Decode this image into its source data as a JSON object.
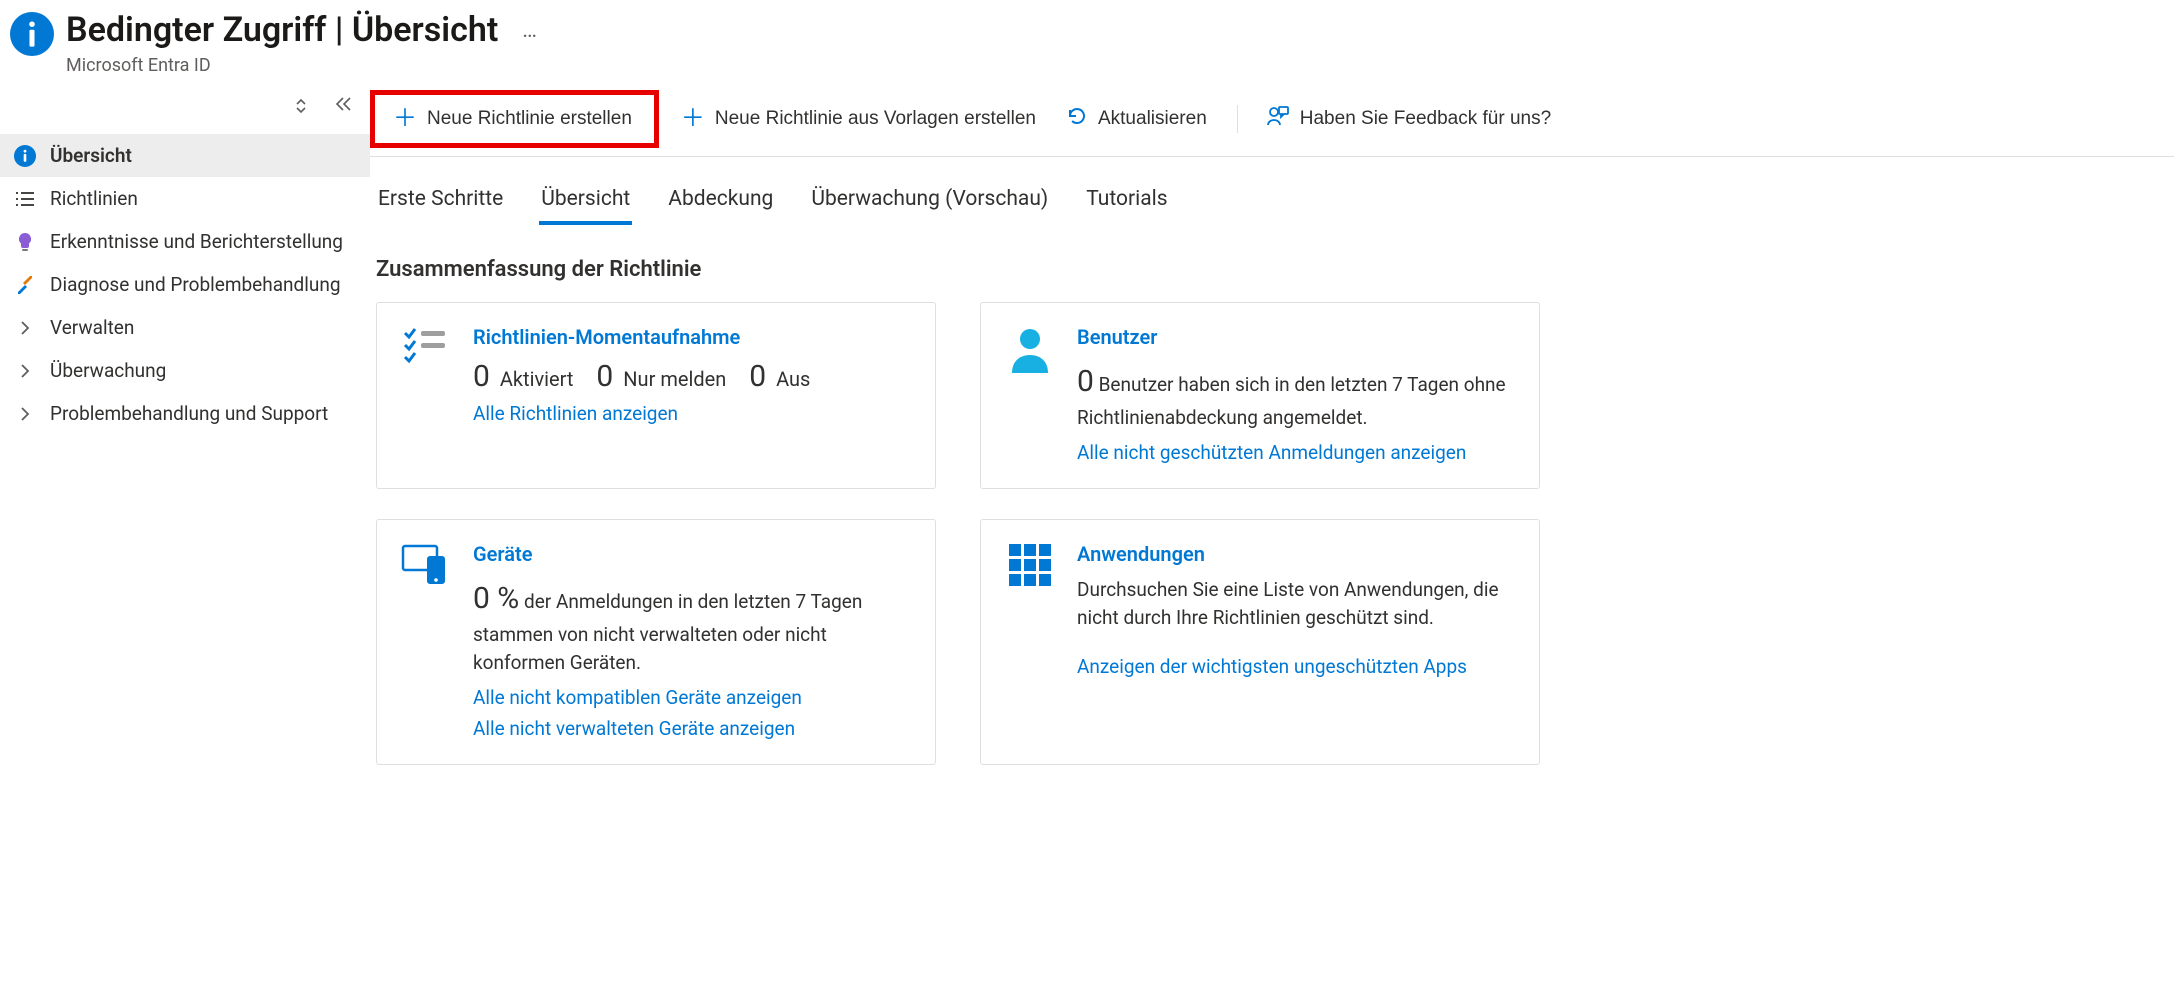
{
  "header": {
    "title": "Bedingter Zugriff | Übersicht",
    "subtitle": "Microsoft Entra ID",
    "ellipsis": "…"
  },
  "sidebar": {
    "items": [
      {
        "label": "Übersicht",
        "icon": "info-circle",
        "active": true
      },
      {
        "label": "Richtlinien",
        "icon": "list",
        "active": false
      },
      {
        "label": "Erkenntnisse und Berichterstellung",
        "icon": "bulb",
        "active": false
      },
      {
        "label": "Diagnose und Problembehandlung",
        "icon": "tools",
        "active": false
      },
      {
        "label": "Verwalten",
        "icon": "chevron",
        "active": false
      },
      {
        "label": "Überwachung",
        "icon": "chevron",
        "active": false
      },
      {
        "label": "Problembehandlung und Support",
        "icon": "chevron",
        "active": false
      }
    ]
  },
  "commandbar": {
    "new_policy": "Neue Richtlinie erstellen",
    "new_from_template": "Neue Richtlinie aus Vorlagen erstellen",
    "refresh": "Aktualisieren",
    "feedback": "Haben Sie Feedback für uns?"
  },
  "tabs": [
    {
      "label": "Erste Schritte",
      "active": false
    },
    {
      "label": "Übersicht",
      "active": true
    },
    {
      "label": "Abdeckung",
      "active": false
    },
    {
      "label": "Überwachung (Vorschau)",
      "active": false
    },
    {
      "label": "Tutorials",
      "active": false
    }
  ],
  "section_title": "Zusammenfassung der Richtlinie",
  "cards": {
    "snapshot": {
      "title": "Richtlinien-Momentaufnahme",
      "activated_count": "0",
      "activated_label": "Aktiviert",
      "report_count": "0",
      "report_label": "Nur melden",
      "off_count": "0",
      "off_label": "Aus",
      "link": "Alle Richtlinien anzeigen"
    },
    "users": {
      "title": "Benutzer",
      "count": "0",
      "desc": "Benutzer haben sich in den letzten 7 Tagen ohne Richtlinienabdeckung angemeldet.",
      "link": "Alle nicht geschützten Anmeldungen anzeigen"
    },
    "devices": {
      "title": "Geräte",
      "count": "0 %",
      "desc": "der Anmeldungen in den letzten 7 Tagen stammen von nicht verwalteten oder nicht konformen Geräten.",
      "link1": "Alle nicht kompatiblen Geräte anzeigen",
      "link2": "Alle nicht verwalteten Geräte anzeigen"
    },
    "apps": {
      "title": "Anwendungen",
      "desc": "Durchsuchen Sie eine Liste von Anwendungen, die nicht durch Ihre Richtlinien geschützt sind.",
      "link": "Anzeigen der wichtigsten ungeschützten Apps"
    }
  }
}
